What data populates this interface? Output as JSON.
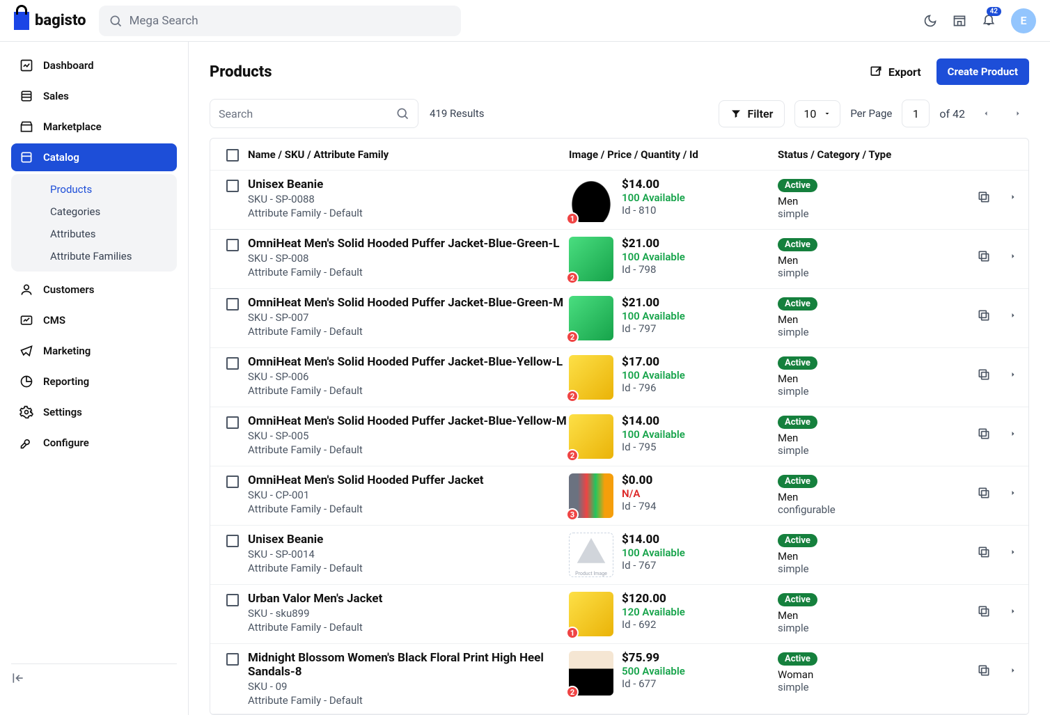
{
  "brand": "bagisto",
  "search_placeholder": "Mega Search",
  "notifications": "42",
  "avatar_initial": "E",
  "sidebar": {
    "items": [
      {
        "label": "Dashboard"
      },
      {
        "label": "Sales"
      },
      {
        "label": "Marketplace"
      },
      {
        "label": "Catalog"
      },
      {
        "label": "Customers"
      },
      {
        "label": "CMS"
      },
      {
        "label": "Marketing"
      },
      {
        "label": "Reporting"
      },
      {
        "label": "Settings"
      },
      {
        "label": "Configure"
      }
    ],
    "catalog_sub": [
      {
        "label": "Products"
      },
      {
        "label": "Categories"
      },
      {
        "label": "Attributes"
      },
      {
        "label": "Attribute Families"
      }
    ]
  },
  "page": {
    "title": "Products",
    "export": "Export",
    "create": "Create Product",
    "table_search_placeholder": "Search",
    "results": "419 Results",
    "filter": "Filter",
    "per_value": "10",
    "per_label": "Per Page",
    "page_current": "1",
    "page_of": "of 42"
  },
  "headers": {
    "col1": "Name / SKU / Attribute Family",
    "col2": "Image / Price / Quantity / Id",
    "col3": "Status / Category / Type"
  },
  "rows": [
    {
      "name": "Unisex Beanie",
      "sku": "SKU - SP-0088",
      "af": "Attribute Family - Default",
      "price": "$14.00",
      "avail": "100 Available",
      "id": "Id - 810",
      "status": "Active",
      "cat": "Men",
      "type": "simple",
      "badge": "1",
      "thumb": "t-beanie"
    },
    {
      "name": "OmniHeat Men's Solid Hooded Puffer Jacket-Blue-Green-L",
      "sku": "SKU - SP-008",
      "af": "Attribute Family - Default",
      "price": "$21.00",
      "avail": "100 Available",
      "id": "Id - 798",
      "status": "Active",
      "cat": "Men",
      "type": "simple",
      "badge": "2",
      "thumb": "t-green"
    },
    {
      "name": "OmniHeat Men's Solid Hooded Puffer Jacket-Blue-Green-M",
      "sku": "SKU - SP-007",
      "af": "Attribute Family - Default",
      "price": "$21.00",
      "avail": "100 Available",
      "id": "Id - 797",
      "status": "Active",
      "cat": "Men",
      "type": "simple",
      "badge": "2",
      "thumb": "t-green"
    },
    {
      "name": "OmniHeat Men's Solid Hooded Puffer Jacket-Blue-Yellow-L",
      "sku": "SKU - SP-006",
      "af": "Attribute Family - Default",
      "price": "$17.00",
      "avail": "100 Available",
      "id": "Id - 796",
      "status": "Active",
      "cat": "Men",
      "type": "simple",
      "badge": "2",
      "thumb": "t-yellow"
    },
    {
      "name": "OmniHeat Men's Solid Hooded Puffer Jacket-Blue-Yellow-M",
      "sku": "SKU - SP-005",
      "af": "Attribute Family - Default",
      "price": "$14.00",
      "avail": "100 Available",
      "id": "Id - 795",
      "status": "Active",
      "cat": "Men",
      "type": "simple",
      "badge": "2",
      "thumb": "t-yellow"
    },
    {
      "name": "OmniHeat Men's Solid Hooded Puffer Jacket",
      "sku": "SKU - CP-001",
      "af": "Attribute Family - Default",
      "price": "$0.00",
      "avail": "N/A",
      "avail_na": true,
      "id": "Id - 794",
      "status": "Active",
      "cat": "Men",
      "type": "configurable",
      "badge": "3",
      "thumb": "t-multi"
    },
    {
      "name": "Unisex Beanie",
      "sku": "SKU - SP-0014",
      "af": "Attribute Family - Default",
      "price": "$14.00",
      "avail": "100 Available",
      "id": "Id - 767",
      "status": "Active",
      "cat": "Men",
      "type": "simple",
      "placeholder": true,
      "ph_label": "Product Image"
    },
    {
      "name": "Urban Valor Men's Jacket",
      "sku": "SKU - sku899",
      "af": "Attribute Family - Default",
      "price": "$120.00",
      "avail": "120 Available",
      "id": "Id - 692",
      "status": "Active",
      "cat": "Men",
      "type": "simple",
      "badge": "1",
      "thumb": "t-yellow"
    },
    {
      "name": "Midnight Blossom Women's Black Floral Print High Heel Sandals-8",
      "sku": "SKU - 09",
      "af": "Attribute Family - Default",
      "price": "$75.99",
      "avail": "500 Available",
      "id": "Id - 677",
      "status": "Active",
      "cat": "Woman",
      "type": "simple",
      "badge": "2",
      "thumb": "t-heel"
    }
  ]
}
